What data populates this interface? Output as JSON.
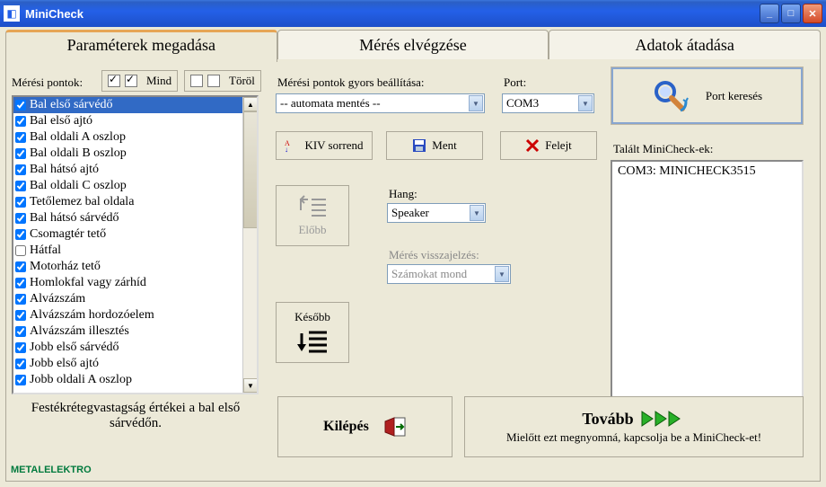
{
  "window": {
    "title": "MiniCheck"
  },
  "tabs": [
    {
      "label": "Paraméterek megadása"
    },
    {
      "label": "Mérés elvégzése"
    },
    {
      "label": "Adatok átadása"
    }
  ],
  "mp": {
    "label": "Mérési pontok:",
    "mind": "Mind",
    "torol": "Töröl"
  },
  "points": [
    {
      "label": "Bal első sárvédő",
      "checked": true,
      "selected": true
    },
    {
      "label": "Bal első ajtó",
      "checked": true
    },
    {
      "label": "Bal oldali A oszlop",
      "checked": true
    },
    {
      "label": "Bal oldali B oszlop",
      "checked": true
    },
    {
      "label": "Bal hátsó ajtó",
      "checked": true
    },
    {
      "label": "Bal oldali C oszlop",
      "checked": true
    },
    {
      "label": "Tetőlemez bal oldala",
      "checked": true
    },
    {
      "label": "Bal hátsó sárvédő",
      "checked": true
    },
    {
      "label": "Csomagtér tető",
      "checked": true
    },
    {
      "label": "Hátfal",
      "checked": false
    },
    {
      "label": "Motorház tető",
      "checked": true
    },
    {
      "label": "Homlokfal vagy zárhíd",
      "checked": true
    },
    {
      "label": "Alvázszám",
      "checked": true
    },
    {
      "label": "Alvázszám hordozóelem",
      "checked": true
    },
    {
      "label": "Alvázszám illesztés",
      "checked": true
    },
    {
      "label": "Jobb első sárvédő",
      "checked": true
    },
    {
      "label": "Jobb első ajtó",
      "checked": true
    },
    {
      "label": "Jobb oldali A oszlop",
      "checked": true
    }
  ],
  "quick": {
    "label": "Mérési pontok gyors beállítása:",
    "value": "-- automata mentés --"
  },
  "port": {
    "label": "Port:",
    "value": "COM3"
  },
  "buttons": {
    "kiv": "KIV sorrend",
    "ment": "Ment",
    "felejt": "Felejt",
    "elobb": "Előbb",
    "kesobb": "Később",
    "port_kereses": "Port keresés",
    "kilepes": "Kilépés",
    "tovabb": "Tovább",
    "tovabb_sub": "Mielőtt ezt megnyomná, kapcsolja be a MiniCheck-et!"
  },
  "hang": {
    "label": "Hang:",
    "value": "Speaker"
  },
  "vissza": {
    "label": "Mérés visszajelzés:",
    "value": "Számokat mond"
  },
  "found": {
    "label": "Talált MiniCheck-ek:",
    "value": "COM3: MINICHECK3515"
  },
  "footer": "Festékrétegvastagság értékei a bal első sárvédőn.",
  "brand": "METALELEKTRO"
}
